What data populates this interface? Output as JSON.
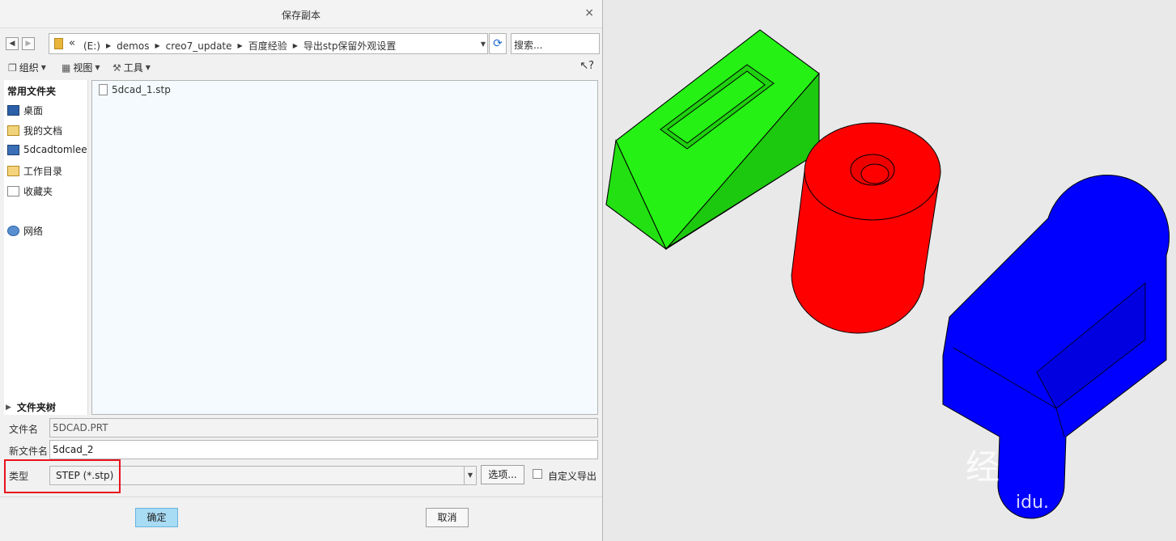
{
  "dialog": {
    "title": "保存副本",
    "close_label": "×"
  },
  "nav": {
    "back": "◀",
    "forward": "▶",
    "chevron": "«",
    "breadcrumbs": [
      "(E:)",
      "demos",
      "creo7_update",
      "百度经验",
      "导出stp保留外观设置"
    ],
    "search_placeholder": "搜索..."
  },
  "toolbar": {
    "organize": "组织",
    "view": "视图",
    "tools": "工具",
    "help": "?"
  },
  "sidebar": {
    "header": "常用文件夹",
    "items": [
      {
        "label": "桌面",
        "icon": "desktop-icon"
      },
      {
        "label": "我的文档",
        "icon": "documents-icon"
      },
      {
        "label": "5dcadtomlee",
        "icon": "computer-icon"
      },
      {
        "label": "工作目录",
        "icon": "working-dir-icon"
      },
      {
        "label": "收藏夹",
        "icon": "favorites-icon"
      },
      {
        "label": "网络",
        "icon": "network-icon"
      }
    ],
    "tree_header": "文件夹树"
  },
  "files": [
    {
      "name": "5dcad_1.stp"
    }
  ],
  "form": {
    "filename_label": "文件名",
    "filename_value": "5DCAD.PRT",
    "newname_label": "新文件名",
    "newname_value": "5dcad_2",
    "type_label": "类型",
    "type_value": "STEP (*.stp)",
    "options_button": "选项...",
    "custom_export_label": "自定义导出"
  },
  "buttons": {
    "ok": "确定",
    "cancel": "取消"
  },
  "colors": {
    "highlight_box": "#e8131b",
    "green_part": "#22ee11",
    "red_part": "#ff0000",
    "blue_part": "#0000ff",
    "ok_button": "#a8dbf4"
  },
  "viewport": {
    "watermark_glyph": "经",
    "watermark_text": "idu."
  }
}
